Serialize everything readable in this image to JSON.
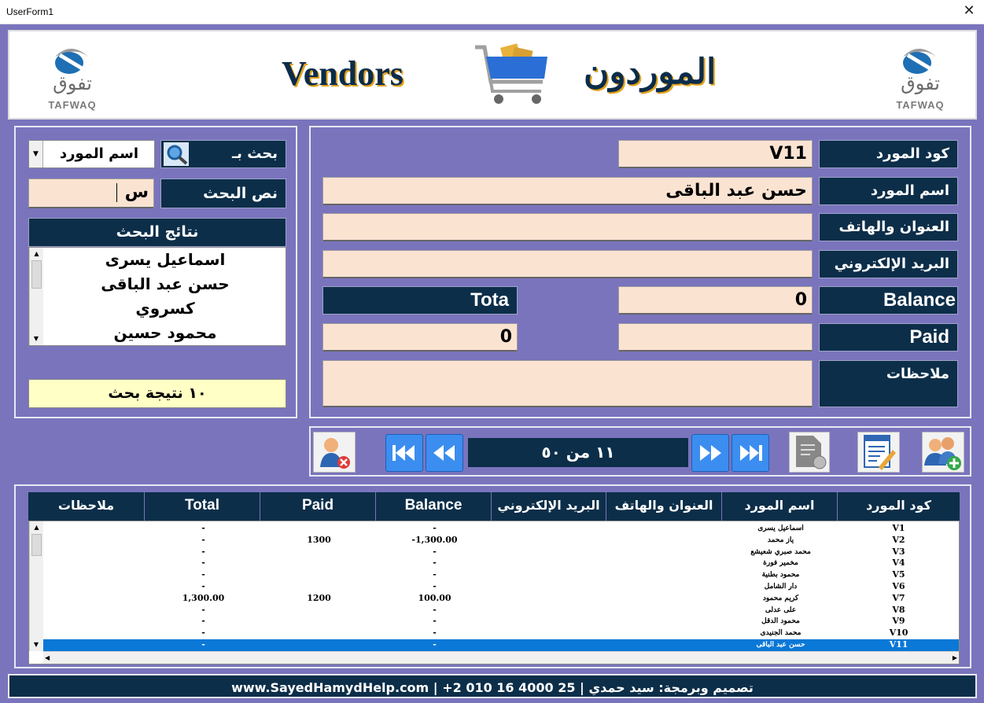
{
  "window": {
    "title": "UserForm1",
    "close_glyph": "✕"
  },
  "header": {
    "title_en": "Vendors",
    "title_ar": "الموردون",
    "logo_ar": "تفوق",
    "logo_en": "TAFWAQ",
    "cart_icon": "shopping-cart-icon"
  },
  "search": {
    "search_by_label": "بحث بـ",
    "search_by_value": "اسم المورد",
    "search_text_label": "نص البحث",
    "search_text_value": "س",
    "results_header": "نتائج البحث",
    "results": [
      "اسماعيل يسرى",
      "حسن عبد الباقى",
      "كسروي",
      "محمود حسين"
    ],
    "results_count": "١٠ نتيجة بحث"
  },
  "form": {
    "code_label": "كود المورد",
    "code_value": "V11",
    "name_label": "اسم المورد",
    "name_value": "حسن عبد الباقى",
    "address_label": "العنوان والهاتف",
    "address_value": "",
    "email_label": "البريد الإلكتروني",
    "email_value": "",
    "balance_label": "Balance",
    "balance_value": "0",
    "total_label": "Tota",
    "paid_label": "Paid",
    "paid_value": "",
    "total_value": "0",
    "notes_label": "ملاحظات",
    "notes_value": ""
  },
  "nav": {
    "record_position": "١١ من ٥٠"
  },
  "grid": {
    "headers": [
      "كود المورد",
      "اسم المورد",
      "العنوان والهاتف",
      "البريد الإلكتروني",
      "Balance",
      "Paid",
      "Total",
      "ملاحظات"
    ],
    "rows": [
      {
        "code": "V1",
        "name": "اسماعيل يسرى",
        "address": "",
        "email": "",
        "balance": "-",
        "paid": "",
        "total": "-",
        "notes": ""
      },
      {
        "code": "V2",
        "name": "ياز محمد",
        "address": "",
        "email": "",
        "balance": "-1,300.00",
        "paid": "1300",
        "total": "-",
        "notes": ""
      },
      {
        "code": "V3",
        "name": "محمد صبري شعيشع",
        "address": "",
        "email": "",
        "balance": "-",
        "paid": "",
        "total": "-",
        "notes": ""
      },
      {
        "code": "V4",
        "name": "مخمير فورة",
        "address": "",
        "email": "",
        "balance": "-",
        "paid": "",
        "total": "-",
        "notes": ""
      },
      {
        "code": "V5",
        "name": "محمود بطنية",
        "address": "",
        "email": "",
        "balance": "-",
        "paid": "",
        "total": "-",
        "notes": ""
      },
      {
        "code": "V6",
        "name": "دار الشامل",
        "address": "",
        "email": "",
        "balance": "-",
        "paid": "",
        "total": "-",
        "notes": ""
      },
      {
        "code": "V7",
        "name": "كريم محمود",
        "address": "",
        "email": "",
        "balance": "100.00",
        "paid": "1200",
        "total": "1,300.00",
        "notes": ""
      },
      {
        "code": "V8",
        "name": "على عدلى",
        "address": "",
        "email": "",
        "balance": "-",
        "paid": "",
        "total": "-",
        "notes": ""
      },
      {
        "code": "V9",
        "name": "محمود الدقل",
        "address": "",
        "email": "",
        "balance": "-",
        "paid": "",
        "total": "-",
        "notes": ""
      },
      {
        "code": "V10",
        "name": "محمد الجنيدى",
        "address": "",
        "email": "",
        "balance": "-",
        "paid": "",
        "total": "-",
        "notes": ""
      },
      {
        "code": "V11",
        "name": "حسن عبد الباقى",
        "address": "",
        "email": "",
        "balance": "-",
        "paid": "",
        "total": "-",
        "notes": ""
      }
    ],
    "selected_index": 10
  },
  "status": {
    "text": "www.SayedHamydHelp.com  | +2  010  16  4000  25  |  تصميم وبرمجة: سيد حمدي"
  },
  "colors": {
    "label_bg": "#0c2e49",
    "field_bg": "#fbe3d2",
    "form_bg": "#7a74bd",
    "selected_row": "#0a78d7"
  }
}
